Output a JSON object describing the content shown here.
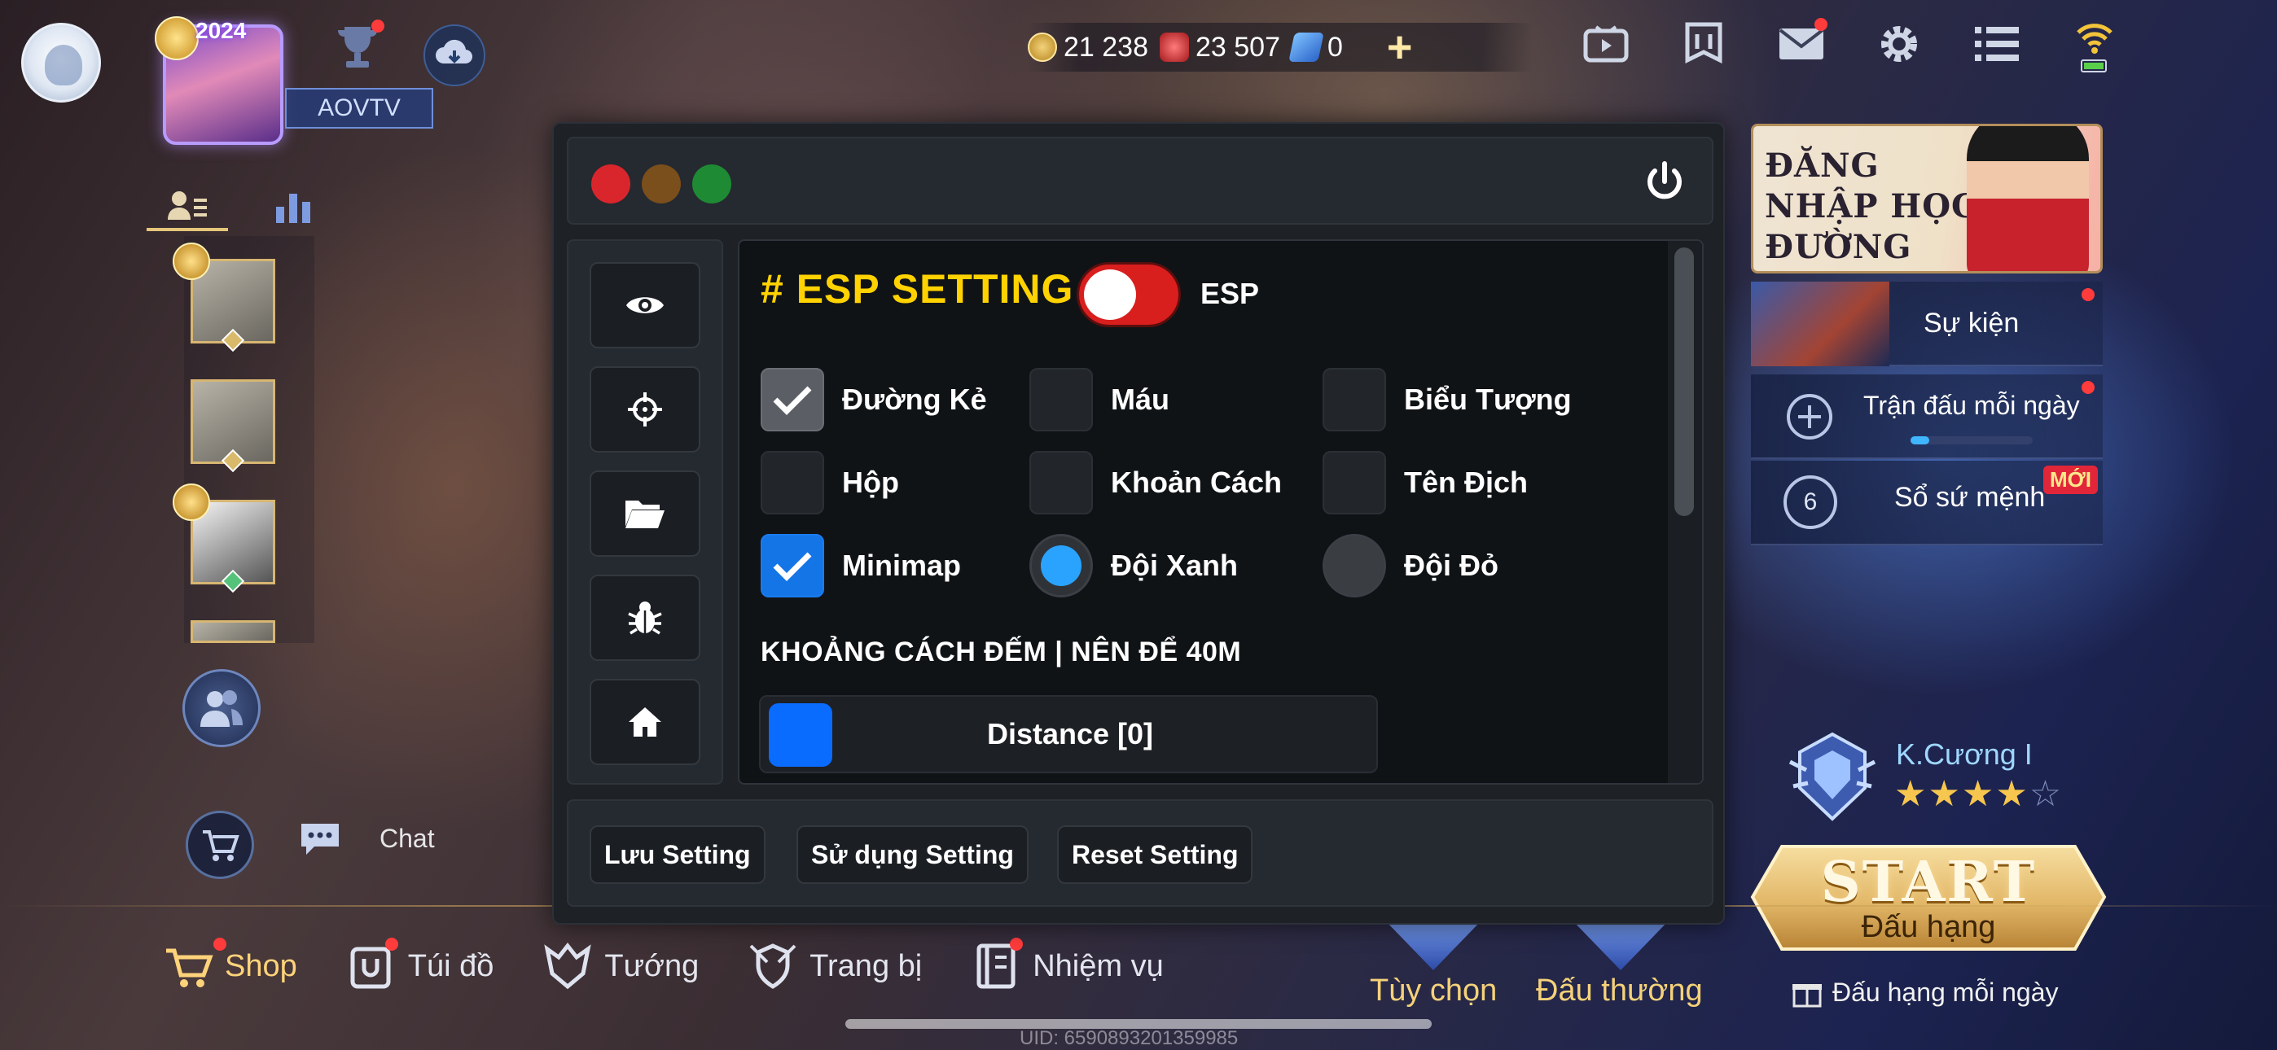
{
  "profile": {
    "year_badge": "2024",
    "username": "AOVTV"
  },
  "currency": {
    "gold": "21 238",
    "gems": "23 507",
    "vouchers": "0",
    "add_label": "+"
  },
  "top_icons": [
    "video-icon",
    "guild-banner-icon",
    "mail-icon",
    "settings-gear-icon",
    "menu-list-icon",
    "wifi-battery-icon"
  ],
  "side_panel": {
    "banner_text": "ĐĂNG NHẬP HỌC ĐƯỜNG",
    "items": [
      {
        "label": "Sự kiện"
      },
      {
        "label": "Trận đấu mỗi ngày",
        "progress": 0.15
      },
      {
        "label": "Sổ sứ mệnh",
        "badge": "MỚI",
        "count": "6"
      }
    ]
  },
  "rank": {
    "name": "K.Cương I",
    "stars": "★★★★",
    "empty_star": "☆"
  },
  "start": {
    "title": "START",
    "subtitle": "Đấu hạng",
    "daily": "Đấu hạng mỗi ngày"
  },
  "left": {
    "chat_label": "Chat"
  },
  "bottom_nav": [
    {
      "label": "Shop"
    },
    {
      "label": "Túi đồ"
    },
    {
      "label": "Tướng"
    },
    {
      "label": "Trang bị"
    },
    {
      "label": "Nhiệm vụ"
    }
  ],
  "modes": {
    "custom": "Tùy chọn",
    "normal": "Đấu thường"
  },
  "uid": "UID: 6590893201359985",
  "panel": {
    "title": "# ESP SETTING",
    "esp_toggle_label": "ESP",
    "esp_enabled": true,
    "options": [
      {
        "label": "Đường Kẻ",
        "checked": true
      },
      {
        "label": "Máu",
        "checked": false
      },
      {
        "label": "Biểu Tượng",
        "checked": false
      },
      {
        "label": "Hộp",
        "checked": false
      },
      {
        "label": "Khoản Cách",
        "checked": false
      },
      {
        "label": "Tên Địch",
        "checked": false
      },
      {
        "label": "Minimap",
        "checked": true
      },
      {
        "label": "Đội Xanh",
        "selected": true
      },
      {
        "label": "Đội Đỏ",
        "selected": false
      }
    ],
    "distance_title": "KHOẢNG CÁCH ĐẾM | NÊN ĐỂ 40M",
    "distance_label": "Distance [0]",
    "distance_value": 0,
    "buttons": {
      "save": "Lưu Setting",
      "use": "Sử dụng Setting",
      "reset": "Reset Setting"
    },
    "window_colors": {
      "close": "#d9262c",
      "minimize": "#7a4f1c",
      "maximize": "#1f8a34"
    }
  }
}
